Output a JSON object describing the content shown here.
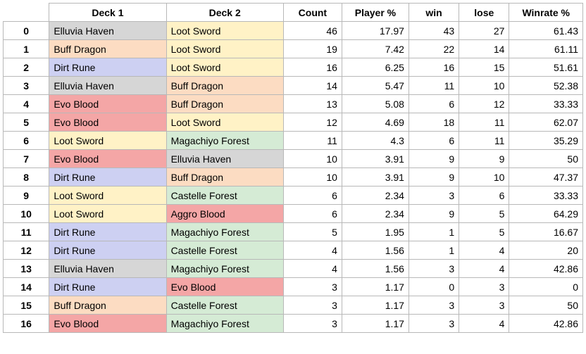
{
  "columns": {
    "idx": "",
    "deck1": "Deck 1",
    "deck2": "Deck 2",
    "count": "Count",
    "playerPct": "Player %",
    "win": "win",
    "lose": "lose",
    "winrate": "Winrate %"
  },
  "deck_colors": {
    "Elluvia Haven": "bg-haven",
    "Loot Sword": "bg-sword",
    "Buff Dragon": "bg-dragon",
    "Dirt Rune": "bg-rune",
    "Evo Blood": "bg-blood",
    "Aggro Blood": "bg-blood",
    "Magachiyo Forest": "bg-forest",
    "Castelle Forest": "bg-forest"
  },
  "rows": [
    {
      "idx": "0",
      "deck1": "Elluvia Haven",
      "deck2": "Loot Sword",
      "count": "46",
      "playerPct": "17.97",
      "win": "43",
      "lose": "27",
      "winrate": "61.43"
    },
    {
      "idx": "1",
      "deck1": "Buff Dragon",
      "deck2": "Loot Sword",
      "count": "19",
      "playerPct": "7.42",
      "win": "22",
      "lose": "14",
      "winrate": "61.11"
    },
    {
      "idx": "2",
      "deck1": "Dirt Rune",
      "deck2": "Loot Sword",
      "count": "16",
      "playerPct": "6.25",
      "win": "16",
      "lose": "15",
      "winrate": "51.61"
    },
    {
      "idx": "3",
      "deck1": "Elluvia Haven",
      "deck2": "Buff Dragon",
      "count": "14",
      "playerPct": "5.47",
      "win": "11",
      "lose": "10",
      "winrate": "52.38"
    },
    {
      "idx": "4",
      "deck1": "Evo Blood",
      "deck2": "Buff Dragon",
      "count": "13",
      "playerPct": "5.08",
      "win": "6",
      "lose": "12",
      "winrate": "33.33"
    },
    {
      "idx": "5",
      "deck1": "Evo Blood",
      "deck2": "Loot Sword",
      "count": "12",
      "playerPct": "4.69",
      "win": "18",
      "lose": "11",
      "winrate": "62.07"
    },
    {
      "idx": "6",
      "deck1": "Loot Sword",
      "deck2": "Magachiyo Forest",
      "count": "11",
      "playerPct": "4.3",
      "win": "6",
      "lose": "11",
      "winrate": "35.29"
    },
    {
      "idx": "7",
      "deck1": "Evo Blood",
      "deck2": "Elluvia Haven",
      "count": "10",
      "playerPct": "3.91",
      "win": "9",
      "lose": "9",
      "winrate": "50"
    },
    {
      "idx": "8",
      "deck1": "Dirt Rune",
      "deck2": "Buff Dragon",
      "count": "10",
      "playerPct": "3.91",
      "win": "9",
      "lose": "10",
      "winrate": "47.37"
    },
    {
      "idx": "9",
      "deck1": "Loot Sword",
      "deck2": "Castelle Forest",
      "count": "6",
      "playerPct": "2.34",
      "win": "3",
      "lose": "6",
      "winrate": "33.33"
    },
    {
      "idx": "10",
      "deck1": "Loot Sword",
      "deck2": "Aggro Blood",
      "count": "6",
      "playerPct": "2.34",
      "win": "9",
      "lose": "5",
      "winrate": "64.29"
    },
    {
      "idx": "11",
      "deck1": "Dirt Rune",
      "deck2": "Magachiyo Forest",
      "count": "5",
      "playerPct": "1.95",
      "win": "1",
      "lose": "5",
      "winrate": "16.67"
    },
    {
      "idx": "12",
      "deck1": "Dirt Rune",
      "deck2": "Castelle Forest",
      "count": "4",
      "playerPct": "1.56",
      "win": "1",
      "lose": "4",
      "winrate": "20"
    },
    {
      "idx": "13",
      "deck1": "Elluvia Haven",
      "deck2": "Magachiyo Forest",
      "count": "4",
      "playerPct": "1.56",
      "win": "3",
      "lose": "4",
      "winrate": "42.86"
    },
    {
      "idx": "14",
      "deck1": "Dirt Rune",
      "deck2": "Evo Blood",
      "count": "3",
      "playerPct": "1.17",
      "win": "0",
      "lose": "3",
      "winrate": "0"
    },
    {
      "idx": "15",
      "deck1": "Buff Dragon",
      "deck2": "Castelle Forest",
      "count": "3",
      "playerPct": "1.17",
      "win": "3",
      "lose": "3",
      "winrate": "50"
    },
    {
      "idx": "16",
      "deck1": "Evo Blood",
      "deck2": "Magachiyo Forest",
      "count": "3",
      "playerPct": "1.17",
      "win": "3",
      "lose": "4",
      "winrate": "42.86"
    }
  ]
}
